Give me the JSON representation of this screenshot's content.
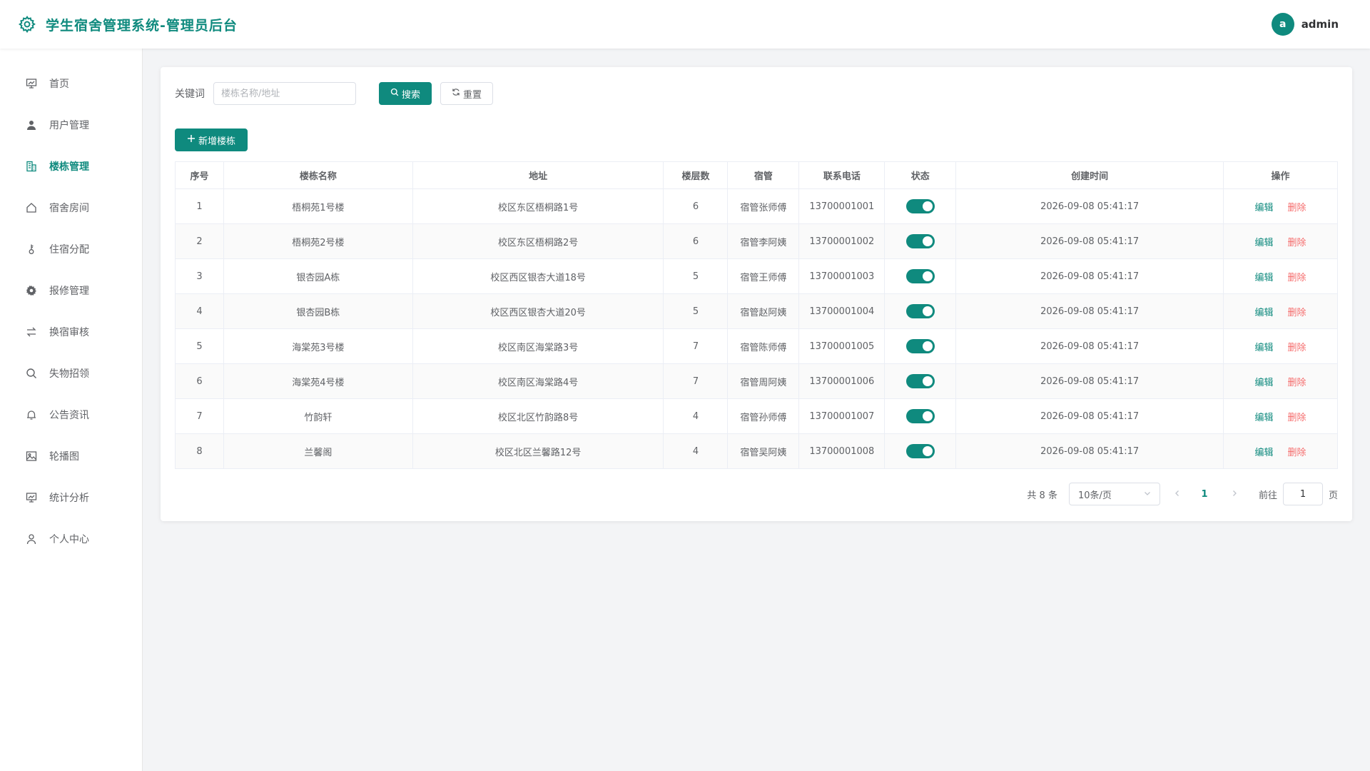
{
  "header": {
    "title": "学生宿舍管理系统-管理员后台",
    "user_initial": "a",
    "username": "admin",
    "accent": "#0f8a7e"
  },
  "sidebar": {
    "items": [
      {
        "label": "首页",
        "icon": "presentation-chart-icon",
        "active": false
      },
      {
        "label": "用户管理",
        "icon": "user-icon",
        "active": false
      },
      {
        "label": "楼栋管理",
        "icon": "building-icon",
        "active": true
      },
      {
        "label": "宿舍房间",
        "icon": "house-icon",
        "active": false
      },
      {
        "label": "住宿分配",
        "icon": "key-icon",
        "active": false
      },
      {
        "label": "报修管理",
        "icon": "gear-icon",
        "active": false
      },
      {
        "label": "换宿审核",
        "icon": "swap-icon",
        "active": false
      },
      {
        "label": "失物招领",
        "icon": "search-icon",
        "active": false
      },
      {
        "label": "公告资讯",
        "icon": "bell-icon",
        "active": false
      },
      {
        "label": "轮播图",
        "icon": "image-icon",
        "active": false
      },
      {
        "label": "统计分析",
        "icon": "presentation-chart-icon",
        "active": false
      },
      {
        "label": "个人中心",
        "icon": "user-outline-icon",
        "active": false
      }
    ]
  },
  "search": {
    "keyword_label": "关键词",
    "keyword_placeholder": "楼栋名称/地址",
    "keyword_value": "",
    "search_label": "搜索",
    "reset_label": "重置"
  },
  "toolbar": {
    "add_label": "新增楼栋"
  },
  "table": {
    "columns": [
      "序号",
      "楼栋名称",
      "地址",
      "楼层数",
      "宿管",
      "联系电话",
      "状态",
      "创建时间",
      "操作"
    ],
    "edit_label": "编辑",
    "delete_label": "删除",
    "rows": [
      {
        "index": "1",
        "name": "梧桐苑1号楼",
        "address": "校区东区梧桐路1号",
        "floors": "6",
        "manager": "宿管张师傅",
        "phone": "13700001001",
        "status": true,
        "created": "2026-09-08 05:41:17"
      },
      {
        "index": "2",
        "name": "梧桐苑2号楼",
        "address": "校区东区梧桐路2号",
        "floors": "6",
        "manager": "宿管李阿姨",
        "phone": "13700001002",
        "status": true,
        "created": "2026-09-08 05:41:17"
      },
      {
        "index": "3",
        "name": "银杏园A栋",
        "address": "校区西区银杏大道18号",
        "floors": "5",
        "manager": "宿管王师傅",
        "phone": "13700001003",
        "status": true,
        "created": "2026-09-08 05:41:17"
      },
      {
        "index": "4",
        "name": "银杏园B栋",
        "address": "校区西区银杏大道20号",
        "floors": "5",
        "manager": "宿管赵阿姨",
        "phone": "13700001004",
        "status": true,
        "created": "2026-09-08 05:41:17"
      },
      {
        "index": "5",
        "name": "海棠苑3号楼",
        "address": "校区南区海棠路3号",
        "floors": "7",
        "manager": "宿管陈师傅",
        "phone": "13700001005",
        "status": true,
        "created": "2026-09-08 05:41:17"
      },
      {
        "index": "6",
        "name": "海棠苑4号楼",
        "address": "校区南区海棠路4号",
        "floors": "7",
        "manager": "宿管周阿姨",
        "phone": "13700001006",
        "status": true,
        "created": "2026-09-08 05:41:17"
      },
      {
        "index": "7",
        "name": "竹韵轩",
        "address": "校区北区竹韵路8号",
        "floors": "4",
        "manager": "宿管孙师傅",
        "phone": "13700001007",
        "status": true,
        "created": "2026-09-08 05:41:17"
      },
      {
        "index": "8",
        "name": "兰馨阁",
        "address": "校区北区兰馨路12号",
        "floors": "4",
        "manager": "宿管吴阿姨",
        "phone": "13700001008",
        "status": true,
        "created": "2026-09-08 05:41:17"
      }
    ]
  },
  "pagination": {
    "total_text": "共 8 条",
    "page_size": "10条/页",
    "current_page": "1",
    "goto_label": "前往",
    "goto_value": "1",
    "page_suffix": "页"
  }
}
